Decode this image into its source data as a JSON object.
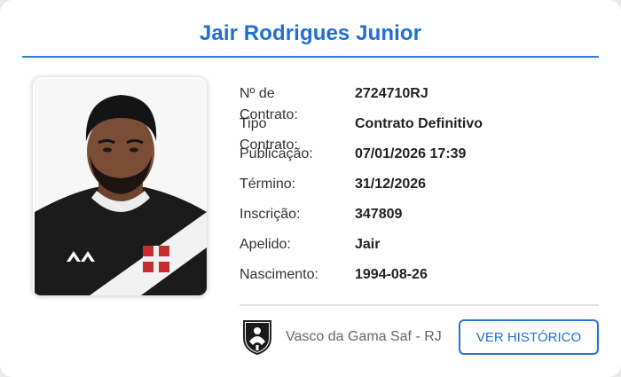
{
  "profile": {
    "name": "Jair Rodrigues Junior"
  },
  "details": [
    {
      "label": "Nº de Contrato:",
      "value": "2724710RJ"
    },
    {
      "label": "Tipo Contrato:",
      "value": "Contrato Definitivo"
    },
    {
      "label": "Publicação:",
      "value": "07/01/2026 17:39"
    },
    {
      "label": "Término:",
      "value": "31/12/2026"
    },
    {
      "label": "Inscrição:",
      "value": "347809"
    },
    {
      "label": "Apelido:",
      "value": "Jair"
    },
    {
      "label": "Nascimento:",
      "value": "1994-08-26"
    }
  ],
  "club": {
    "name": "Vasco da Gama Saf - RJ",
    "crest_icon": "vasco-crest-icon"
  },
  "actions": {
    "history_label": "VER HISTÓRICO"
  },
  "colors": {
    "accent": "#1f6fd1"
  }
}
